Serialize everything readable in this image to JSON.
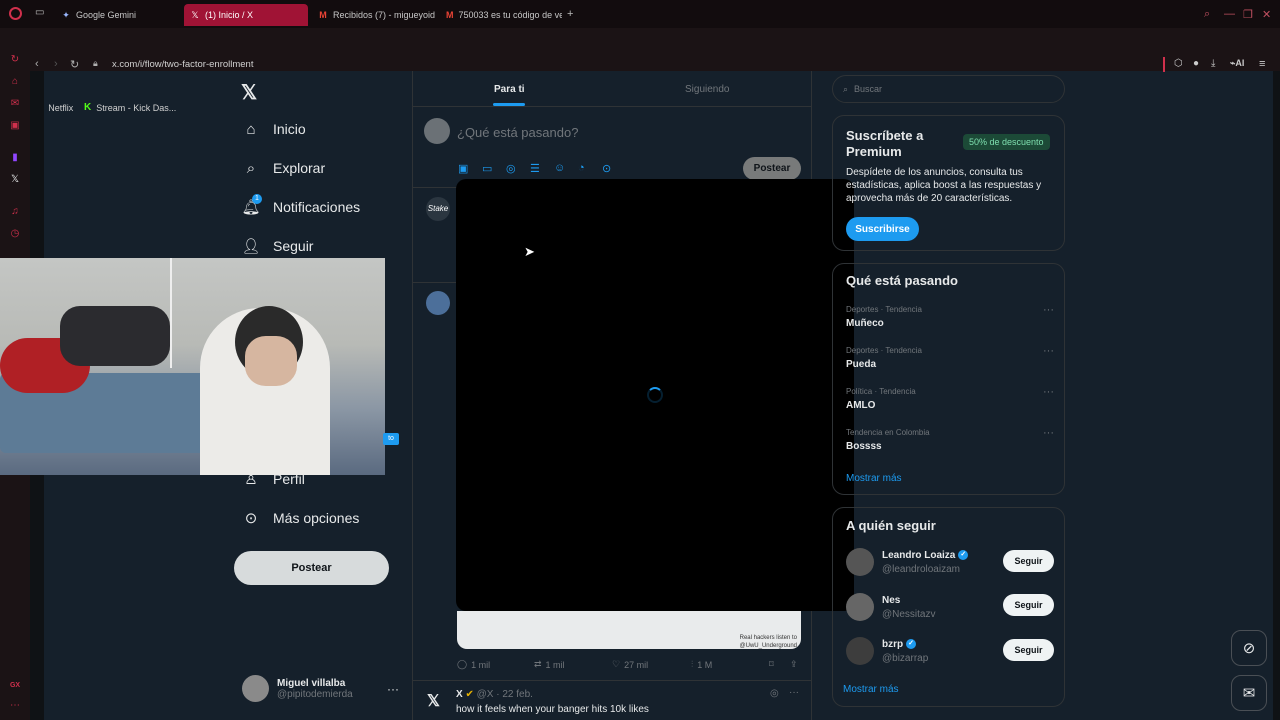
{
  "browser": {
    "tabs": [
      {
        "label": "Google Gemini",
        "icon": "gemini-star-icon"
      },
      {
        "label": "(1) Inicio / X",
        "icon": "x-logo-icon",
        "active": true
      },
      {
        "label": "Recibidos (7) - migueyoid",
        "icon": "gmail-icon"
      },
      {
        "label": "750033 es tu código de ve",
        "icon": "gmail-icon"
      }
    ],
    "url": "x.com/i/flow/two-factor-enrollment",
    "bookmarks": [
      {
        "label": "Netflix",
        "icon": "netflix-icon"
      },
      {
        "label": "Stream - Kick Das...",
        "icon": "kick-icon"
      }
    ],
    "ai_label": "AI",
    "gx_label": "GX",
    "accent_color": "#a01335"
  },
  "nav": {
    "items": [
      {
        "label": "Inicio",
        "icon": "home-icon"
      },
      {
        "label": "Explorar",
        "icon": "search-icon"
      },
      {
        "label": "Notificaciones",
        "icon": "bell-icon",
        "badge": "1"
      },
      {
        "label": "Seguir",
        "icon": "follow-icon"
      },
      {
        "label": "Perfil",
        "icon": "person-icon"
      },
      {
        "label": "Más opciones",
        "icon": "more-circle-icon"
      }
    ],
    "post_button": "Postear",
    "profile": {
      "name": "Miguel villalba",
      "handle": "@pipitodemierda"
    },
    "blue_chip": "to"
  },
  "timeline": {
    "tabs": [
      "Para ti",
      "Siguiendo"
    ],
    "compose_placeholder": "¿Qué está pasando?",
    "compose_button": "Postear",
    "stake_label": "Stake",
    "media_caption_1": "Real hackers listen to",
    "media_caption_2": "@UwU_Underground",
    "actions": {
      "replies": "1 mil",
      "reposts": "1 mil",
      "likes": "27 mil",
      "views": "1 M"
    },
    "x_post": {
      "name": "X",
      "handle": "@X · 22 feb.",
      "text": "how it feels when your banger hits 10k likes"
    }
  },
  "right": {
    "search_placeholder": "Buscar",
    "premium": {
      "title": "Suscríbete a Premium",
      "discount": "50% de descuento",
      "description": "Despídete de los anuncios, consulta tus estadísticas, aplica boost a las respuestas y aprovecha más de 20 características.",
      "button": "Suscribirse"
    },
    "trends": {
      "heading": "Qué está pasando",
      "items": [
        {
          "category": "Deportes · Tendencia",
          "name": "Muñeco"
        },
        {
          "category": "Deportes · Tendencia",
          "name": "Pueda"
        },
        {
          "category": "Política · Tendencia",
          "name": "AMLO"
        },
        {
          "category": "Tendencia en Colombia",
          "name": "Bossss"
        }
      ],
      "more": "Mostrar más"
    },
    "who_to_follow": {
      "heading": "A quién seguir",
      "users": [
        {
          "name": "Leandro Loaiza",
          "handle": "@leandroloaizam",
          "verified": true
        },
        {
          "name": "Nes",
          "handle": "@Nessitazv",
          "verified": false
        },
        {
          "name": "bzrp",
          "handle": "@bizarrap",
          "verified": true
        }
      ],
      "button": "Seguir",
      "more": "Mostrar más"
    }
  }
}
